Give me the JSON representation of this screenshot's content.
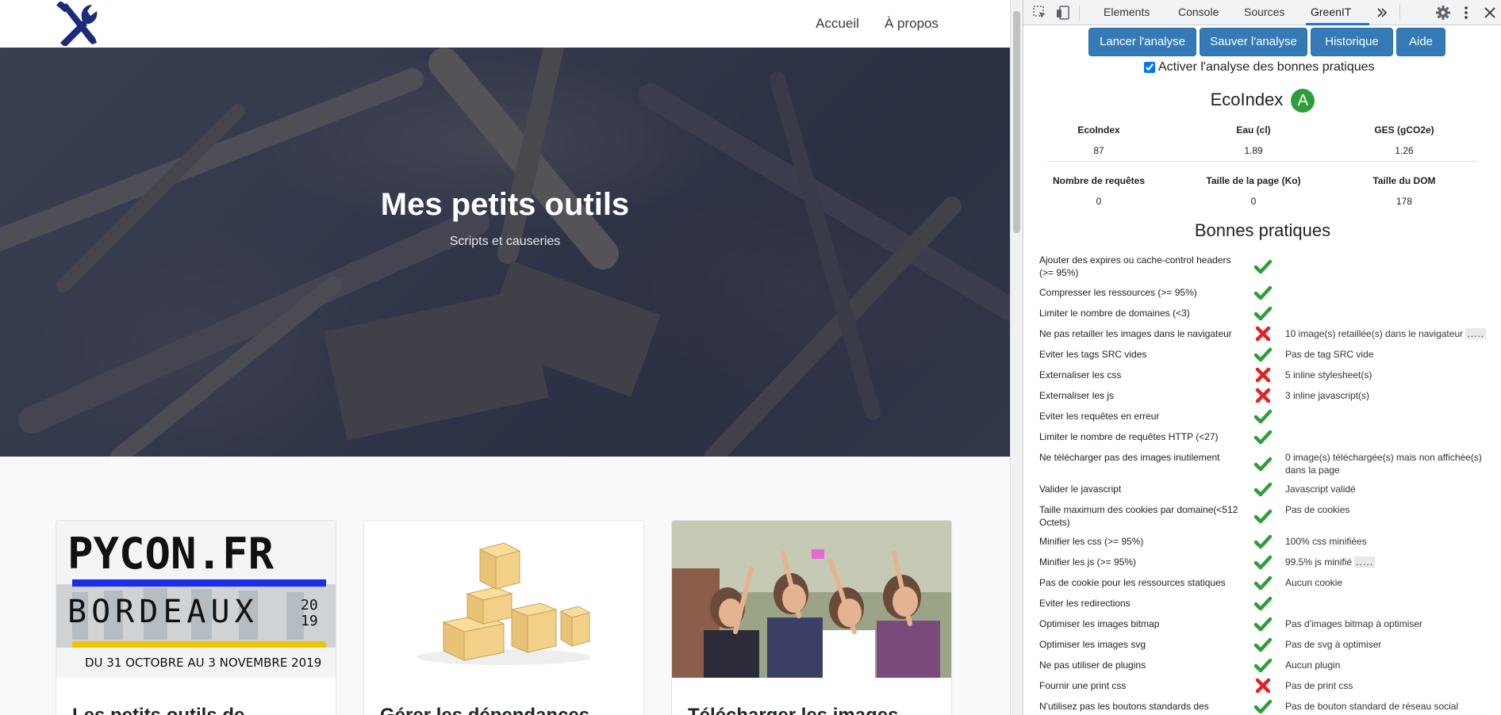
{
  "site": {
    "nav": {
      "links": [
        "Accueil",
        "À propos"
      ]
    },
    "hero": {
      "title": "Mes petits outils",
      "subtitle": "Scripts et causeries"
    },
    "cards": [
      {
        "image_text": {
          "line1": "PYCON.FR",
          "line2": "BORDEAUX",
          "year_top": "20",
          "year_bottom": "19",
          "dates": "DU 31 OCTOBRE AU 3 NOVEMBRE 2019"
        },
        "title": "Les petits outils de"
      },
      {
        "title": "Gérer les dépendances"
      },
      {
        "title": "Télécharger les images"
      }
    ]
  },
  "devtools": {
    "tabs": [
      "Elements",
      "Console",
      "Sources",
      "GreenIT"
    ],
    "active_tab": "GreenIT",
    "buttons": [
      "Lancer l'analyse",
      "Sauver l'analyse",
      "Historique",
      "Aide"
    ],
    "checkbox_label": "Activer l'analyse des bonnes pratiques",
    "ecoindex": {
      "title": "EcoIndex",
      "grade": "A"
    },
    "stats_row1": [
      {
        "label": "EcoIndex",
        "value": "87"
      },
      {
        "label": "Eau (cl)",
        "value": "1.89"
      },
      {
        "label": "GES (gCO2e)",
        "value": "1.26"
      }
    ],
    "stats_row2": [
      {
        "label": "Nombre de requêtes",
        "value": "0"
      },
      {
        "label": "Taille de la page (Ko)",
        "value": "0"
      },
      {
        "label": "Taille du DOM",
        "value": "178"
      }
    ],
    "practices_title": "Bonnes pratiques",
    "practices": [
      {
        "name": "Ajouter des expires ou cache-control headers (>= 95%)",
        "ok": true,
        "comment": ""
      },
      {
        "name": "Compresser les ressources (>= 95%)",
        "ok": true,
        "comment": ""
      },
      {
        "name": "Limiter le nombre de domaines (<3)",
        "ok": true,
        "comment": ""
      },
      {
        "name": "Ne pas retailler les images dans le navigateur",
        "ok": false,
        "comment": "10 image(s) retaillée(s) dans le navigateur",
        "more": "....."
      },
      {
        "name": "Eviter les tags SRC vides",
        "ok": true,
        "comment": "Pas de tag SRC vide"
      },
      {
        "name": "Externaliser les css",
        "ok": false,
        "comment": "5 inline stylesheet(s)"
      },
      {
        "name": "Externaliser les js",
        "ok": false,
        "comment": "3 inline javascript(s)"
      },
      {
        "name": "Eviter les requêtes en erreur",
        "ok": true,
        "comment": ""
      },
      {
        "name": "Limiter le nombre de requêtes HTTP (<27)",
        "ok": true,
        "comment": ""
      },
      {
        "name": "Ne télécharger pas des images inutilement",
        "ok": true,
        "comment": "0 image(s) téléchargée(s) mais non affichée(s) dans la page"
      },
      {
        "name": "Valider le javascript",
        "ok": true,
        "comment": "Javascript validé"
      },
      {
        "name": "Taille maximum des cookies par domaine(<512 Octets)",
        "ok": true,
        "comment": "Pas de cookies"
      },
      {
        "name": "Minifier les css (>= 95%)",
        "ok": true,
        "comment": "100% css minifiées"
      },
      {
        "name": "Minifier les js (>= 95%)",
        "ok": true,
        "comment": "99.5% js minifié",
        "more": "....."
      },
      {
        "name": "Pas de cookie pour les ressources statiques",
        "ok": true,
        "comment": "Aucun cookie"
      },
      {
        "name": "Eviter les redirections",
        "ok": true,
        "comment": ""
      },
      {
        "name": "Optimiser les images bitmap",
        "ok": true,
        "comment": "Pas d'images bitmap à optimiser"
      },
      {
        "name": "Optimiser les images svg",
        "ok": true,
        "comment": "Pas de svg à optimiser"
      },
      {
        "name": "Ne pas utiliser de plugins",
        "ok": true,
        "comment": "Aucun plugin"
      },
      {
        "name": "Fournir une print css",
        "ok": false,
        "comment": "Pas de print css"
      },
      {
        "name": "N'utilisez pas les boutons standards des",
        "ok": true,
        "comment": "Pas de bouton standard de réseau social"
      }
    ],
    "colors": {
      "ok": "#2e9e3a",
      "fail": "#e02424",
      "button": "#337ab7"
    }
  }
}
